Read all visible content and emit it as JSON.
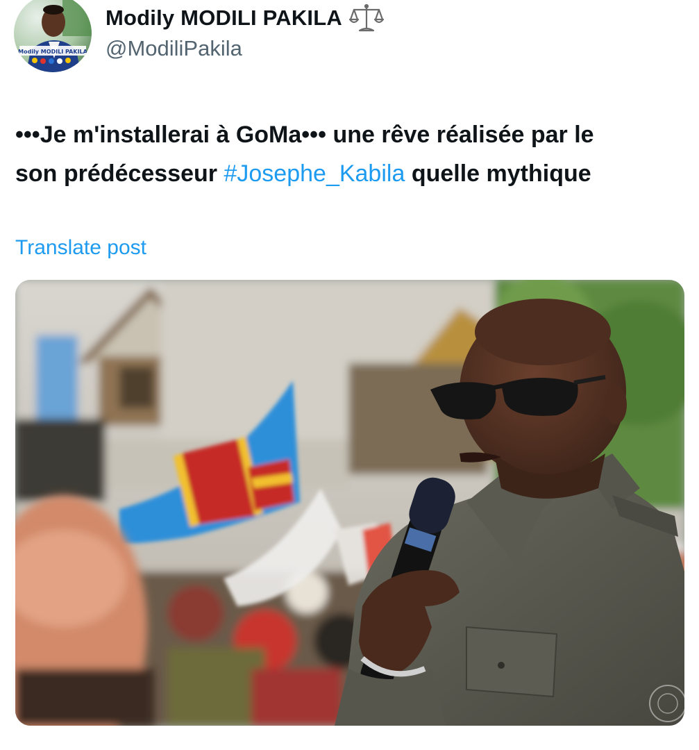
{
  "author": {
    "display_name": "Modily MODILI PAKILA",
    "handle": "@ModiliPakila",
    "badge_icon": "balance-scale-icon",
    "avatar_badge_text": "Modily MODILI PAKILA"
  },
  "post": {
    "line1_prefix": "•••Je m'installerai à GoMa•••  une rêve réalisée par le",
    "line2_prefix": "son prédécesseur ",
    "hashtag": "#Josephe_Kabila",
    "line2_suffix": " quelle mythique",
    "translate_label": "Translate post",
    "media_alt": "Photo of a man in sunglasses speaking into a microphone in front of a crowd with flags"
  },
  "colors": {
    "link": "#1d9bf0",
    "text": "#0f1419",
    "secondary": "#536471"
  }
}
